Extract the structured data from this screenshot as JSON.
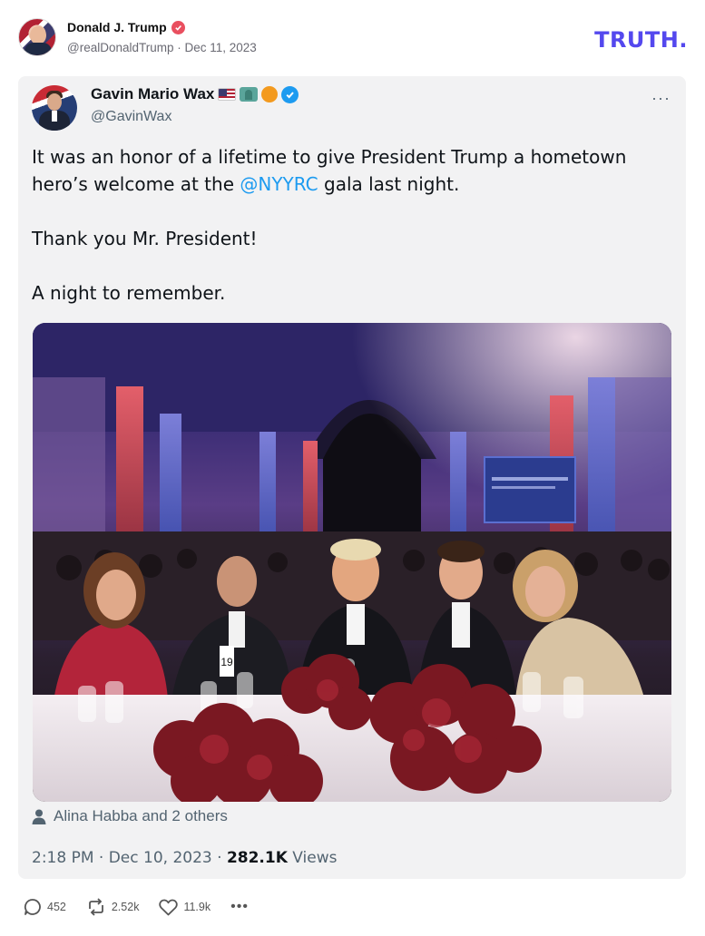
{
  "post": {
    "author_name": "Donald J. Trump",
    "author_handle": "@realDonaldTrump",
    "separator": " · ",
    "date": "Dec 11, 2023",
    "logo": "TRUTH",
    "logo_dot": "."
  },
  "tweet": {
    "name": "Gavin Mario Wax",
    "handle": "@GavinWax",
    "more_label": "···",
    "paragraph_1_before": "It was an honor of a lifetime to give President Trump a hometown hero’s welcome at the ",
    "mention": "@NYYRC",
    "paragraph_1_after": " gala last night.",
    "paragraph_2": "Thank you Mr. President!",
    "paragraph_3": "A night to remember.",
    "tagged": "Alina Habba and 2 others",
    "time": "2:18 PM · Dec 10, 2023 · ",
    "views_count": "282.1K",
    "views_label": " Views",
    "table_number": "19"
  },
  "actions": {
    "replies": "452",
    "retruths": "2.52k",
    "likes": "11.9k",
    "more": "•••"
  },
  "icons": {
    "verified_author": "verified-check-icon",
    "verified_tweet": "verified-check-icon",
    "reply": "comment-icon",
    "retruth": "retruth-icon",
    "like": "heart-icon",
    "person": "person-icon"
  },
  "colors": {
    "brand": "#5448ee",
    "mention": "#1d9bf0",
    "verified_red": "#e94f5f",
    "verified_blue": "#1d9bf0",
    "muted": "#536471"
  }
}
